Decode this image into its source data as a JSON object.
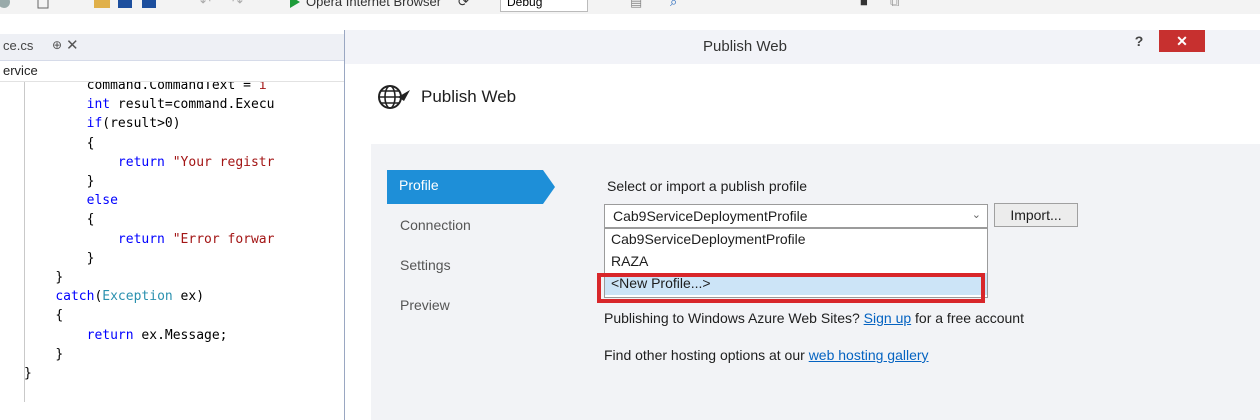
{
  "toolbar": {
    "run_label": "Opera Internet Browser",
    "config_value": "Debug",
    "run_color": "#1e9c3a",
    "icons": [
      "refresh-icon",
      "bookmark-icon",
      "play-icon"
    ]
  },
  "editor": {
    "tab_label": "ce.cs",
    "pin_glyph": "⊕",
    "close_glyph": "✕",
    "nav_label": "ervice",
    "code": [
      {
        "indent": "        ",
        "parts": [
          {
            "t": "command.CommandText = ",
            "c": "p"
          },
          {
            "t": "i",
            "c": "str"
          }
        ]
      },
      {
        "indent": "        ",
        "parts": [
          {
            "t": "int",
            "c": "kw"
          },
          {
            "t": " result=command.Execu",
            "c": "p"
          }
        ]
      },
      {
        "indent": "        ",
        "parts": [
          {
            "t": "if",
            "c": "kw"
          },
          {
            "t": "(result>0)",
            "c": "p"
          }
        ]
      },
      {
        "indent": "        ",
        "parts": [
          {
            "t": "{",
            "c": "p"
          }
        ]
      },
      {
        "indent": "            ",
        "parts": [
          {
            "t": "return",
            "c": "kw"
          },
          {
            "t": " ",
            "c": "p"
          },
          {
            "t": "\"Your registr",
            "c": "str"
          }
        ]
      },
      {
        "indent": "        ",
        "parts": [
          {
            "t": "}",
            "c": "p"
          }
        ]
      },
      {
        "indent": "        ",
        "parts": [
          {
            "t": "else",
            "c": "kw"
          }
        ]
      },
      {
        "indent": "        ",
        "parts": [
          {
            "t": "{",
            "c": "p"
          }
        ]
      },
      {
        "indent": "            ",
        "parts": [
          {
            "t": "return",
            "c": "kw"
          },
          {
            "t": " ",
            "c": "p"
          },
          {
            "t": "\"Error forwar",
            "c": "str"
          }
        ]
      },
      {
        "indent": "        ",
        "parts": [
          {
            "t": "}",
            "c": "p"
          }
        ]
      },
      {
        "indent": "    ",
        "parts": [
          {
            "t": "}",
            "c": "p"
          }
        ]
      },
      {
        "indent": "    ",
        "parts": [
          {
            "t": "catch",
            "c": "kw"
          },
          {
            "t": "(",
            "c": "p"
          },
          {
            "t": "Exception",
            "c": "typ"
          },
          {
            "t": " ex)",
            "c": "p"
          }
        ]
      },
      {
        "indent": "    ",
        "parts": [
          {
            "t": "{",
            "c": "p"
          }
        ]
      },
      {
        "indent": "        ",
        "parts": [
          {
            "t": "return",
            "c": "kw"
          },
          {
            "t": " ex.Message;",
            "c": "p"
          }
        ]
      },
      {
        "indent": "    ",
        "parts": [
          {
            "t": "}",
            "c": "p"
          }
        ]
      },
      {
        "indent": "",
        "parts": [
          {
            "t": "}",
            "c": "p"
          }
        ]
      }
    ]
  },
  "dialog": {
    "title": "Publish Web",
    "help_label": "?",
    "close_label": "✕",
    "close_color": "#c7302f",
    "accent_color": "#1e8fd8",
    "header_title": "Publish Web",
    "header_icon": "globe-publish-icon",
    "sidebar": {
      "items": [
        {
          "label": "Profile",
          "active": true
        },
        {
          "label": "Connection",
          "active": false
        },
        {
          "label": "Settings",
          "active": false
        },
        {
          "label": "Preview",
          "active": false
        }
      ]
    },
    "profile": {
      "prompt": "Select or import a publish profile",
      "selected_profile": "Cab9ServiceDeploymentProfile",
      "import_label": "Import...",
      "options": [
        {
          "label": "Cab9ServiceDeploymentProfile",
          "highlighted": false
        },
        {
          "label": "RAZA",
          "highlighted": false
        },
        {
          "label": "<New Profile...>",
          "highlighted": true
        }
      ],
      "azure_prefix": "Publishing to Windows Azure Web Sites? ",
      "azure_link": "Sign up",
      "azure_suffix": " for a free account",
      "hosting_prefix": "Find other hosting options at our ",
      "hosting_link": "web hosting gallery"
    }
  }
}
